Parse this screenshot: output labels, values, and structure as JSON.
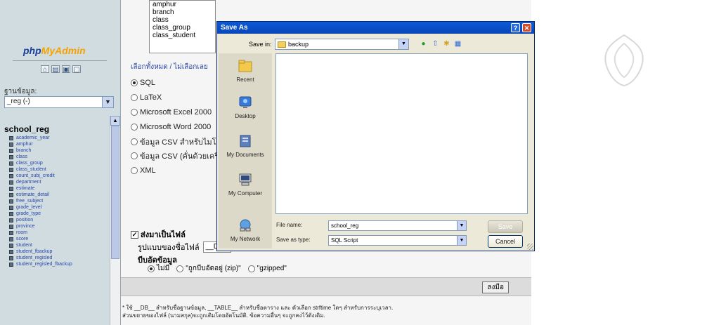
{
  "left_nav": {
    "logo_prefix": "php",
    "logo_accent": "MyAdmin",
    "icons": [
      "home-icon",
      "sql-window-icon",
      "docs-icon",
      "help-icon"
    ],
    "db_label": "ฐานข้อมูล:",
    "db_select_value": "_reg (-)",
    "db_name": "school_reg",
    "tables": [
      "academic_year",
      "amphur",
      "branch",
      "class",
      "class_group",
      "class_student",
      "count_subj_credit",
      "department",
      "estimate",
      "estimate_detail",
      "free_subject",
      "grade_level",
      "grade_type",
      "position",
      "province",
      "room",
      "score",
      "student",
      "student_fbackup",
      "student_regisled",
      "student_regisled_fbackup"
    ]
  },
  "main": {
    "tables_box": [
      "amphur",
      "branch",
      "class",
      "class_group",
      "class_student"
    ],
    "select_links": "เลือกทั้งหมด / ไม่เลือกเลย",
    "export_formats": [
      {
        "label": "SQL",
        "checked": true
      },
      {
        "label": "LaTeX",
        "checked": false
      },
      {
        "label": "Microsoft Excel 2000",
        "checked": false
      },
      {
        "label": "Microsoft Word 2000",
        "checked": false
      },
      {
        "label": "ข้อมูล CSV สำหรับไมโคร",
        "checked": false
      },
      {
        "label": "ข้อมูล CSV (คั่นด้วยเครื่อ",
        "checked": false
      },
      {
        "label": "XML",
        "checked": false
      }
    ],
    "send_as_file": "ส่งมาเป็นไฟล์",
    "filename_template_label": "รูปแบบของชื่อไฟล์",
    "filename_template_value": "__D",
    "compression_title": "บีบอัดข้อมูล",
    "compression_options": [
      {
        "label": "ไม่มี",
        "checked": true
      },
      {
        "label": "\"ถูกบีบอัดอยู่ (zip)\"",
        "checked": false
      },
      {
        "label": "\"gzipped\"",
        "checked": false
      }
    ],
    "go_label": "ลงมือ",
    "footnote_line1": "* ใช้ __DB__ สำหรับชื่อฐานข้อมูล, __TABLE__ สำหรับชื่อตาราง และ ตัวเลือก strftime ใดๆ สำหรับการระบุเวลา.",
    "footnote_line2": "ส่วนขยายของไฟล์ (นามสกุล)จะถูกเติมโดยอัตโนมัติ. ข้อความอื่นๆ จะถูกคงไว้ดังเดิม.",
    "link_color": "#2a47a8"
  },
  "dialog": {
    "title": "Save As",
    "help_button": "?",
    "close_button": "✕",
    "save_in_label": "Save in:",
    "save_in_value": "backup",
    "places": [
      "Recent",
      "Desktop",
      "My Documents",
      "My Computer",
      "My Network"
    ],
    "file_name_label": "File name:",
    "file_name_value": "school_reg",
    "save_as_type_label": "Save as type:",
    "save_as_type_value": "SQL Script",
    "save_button": "Save",
    "cancel_button": "Cancel",
    "title_bar_color": "#0a5ad8"
  }
}
